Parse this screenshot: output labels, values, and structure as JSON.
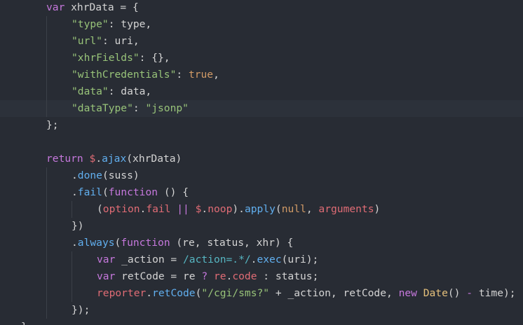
{
  "editor": {
    "theme_colors": {
      "background": "#282c34",
      "keyword": "#c678dd",
      "string": "#98c379",
      "function": "#61afef",
      "variable": "#e06c75",
      "number": "#d19a66",
      "plain": "#d4d4d4",
      "operator": "#56b6c2",
      "class": "#e5c07b"
    },
    "lines": [
      {
        "indent": 1,
        "tokens": [
          {
            "t": "var",
            "c": "keyword"
          },
          {
            "t": " xhrData = {",
            "c": "plain"
          }
        ]
      },
      {
        "indent": 2,
        "tokens": [
          {
            "t": "\"type\"",
            "c": "string"
          },
          {
            "t": ": type,",
            "c": "plain"
          }
        ]
      },
      {
        "indent": 2,
        "tokens": [
          {
            "t": "\"url\"",
            "c": "string"
          },
          {
            "t": ": uri,",
            "c": "plain"
          }
        ]
      },
      {
        "indent": 2,
        "tokens": [
          {
            "t": "\"xhrFields\"",
            "c": "string"
          },
          {
            "t": ": {},",
            "c": "plain"
          }
        ]
      },
      {
        "indent": 2,
        "tokens": [
          {
            "t": "\"withCredentials\"",
            "c": "string"
          },
          {
            "t": ": ",
            "c": "plain"
          },
          {
            "t": "true",
            "c": "number"
          },
          {
            "t": ",",
            "c": "plain"
          }
        ]
      },
      {
        "indent": 2,
        "tokens": [
          {
            "t": "\"data\"",
            "c": "string"
          },
          {
            "t": ": data,",
            "c": "plain"
          }
        ]
      },
      {
        "indent": 2,
        "highlight": true,
        "tokens": [
          {
            "t": "\"dataType\"",
            "c": "string"
          },
          {
            "t": ": ",
            "c": "plain"
          },
          {
            "t": "\"jsonp\"",
            "c": "string"
          }
        ]
      },
      {
        "indent": 1,
        "tokens": [
          {
            "t": "};",
            "c": "plain"
          }
        ]
      },
      {
        "indent": 0,
        "tokens": []
      },
      {
        "indent": 1,
        "tokens": [
          {
            "t": "return",
            "c": "keyword"
          },
          {
            "t": " ",
            "c": "plain"
          },
          {
            "t": "$",
            "c": "variable"
          },
          {
            "t": ".",
            "c": "plain"
          },
          {
            "t": "ajax",
            "c": "function"
          },
          {
            "t": "(xhrData)",
            "c": "plain"
          }
        ]
      },
      {
        "indent": 2,
        "tokens": [
          {
            "t": ".",
            "c": "plain"
          },
          {
            "t": "done",
            "c": "function"
          },
          {
            "t": "(suss)",
            "c": "plain"
          }
        ]
      },
      {
        "indent": 2,
        "tokens": [
          {
            "t": ".",
            "c": "plain"
          },
          {
            "t": "fail",
            "c": "function"
          },
          {
            "t": "(",
            "c": "plain"
          },
          {
            "t": "function",
            "c": "keyword"
          },
          {
            "t": " () {",
            "c": "plain"
          }
        ]
      },
      {
        "indent": 3,
        "tokens": [
          {
            "t": "(",
            "c": "plain"
          },
          {
            "t": "option",
            "c": "variable"
          },
          {
            "t": ".",
            "c": "plain"
          },
          {
            "t": "fail",
            "c": "variable"
          },
          {
            "t": " || ",
            "c": "keyword"
          },
          {
            "t": "$",
            "c": "variable"
          },
          {
            "t": ".",
            "c": "plain"
          },
          {
            "t": "noop",
            "c": "variable"
          },
          {
            "t": ").",
            "c": "plain"
          },
          {
            "t": "apply",
            "c": "function"
          },
          {
            "t": "(",
            "c": "plain"
          },
          {
            "t": "null",
            "c": "number"
          },
          {
            "t": ", ",
            "c": "plain"
          },
          {
            "t": "arguments",
            "c": "variable"
          },
          {
            "t": ")",
            "c": "plain"
          }
        ]
      },
      {
        "indent": 2,
        "tokens": [
          {
            "t": "})",
            "c": "plain"
          }
        ]
      },
      {
        "indent": 2,
        "tokens": [
          {
            "t": ".",
            "c": "plain"
          },
          {
            "t": "always",
            "c": "function"
          },
          {
            "t": "(",
            "c": "plain"
          },
          {
            "t": "function",
            "c": "keyword"
          },
          {
            "t": " (re, status, xhr) {",
            "c": "plain"
          }
        ]
      },
      {
        "indent": 3,
        "tokens": [
          {
            "t": "var",
            "c": "keyword"
          },
          {
            "t": " _action = ",
            "c": "plain"
          },
          {
            "t": "/action=.*/",
            "c": "operator"
          },
          {
            "t": ".",
            "c": "plain"
          },
          {
            "t": "exec",
            "c": "function"
          },
          {
            "t": "(uri);",
            "c": "plain"
          }
        ]
      },
      {
        "indent": 3,
        "tokens": [
          {
            "t": "var",
            "c": "keyword"
          },
          {
            "t": " retCode = re ",
            "c": "plain"
          },
          {
            "t": "?",
            "c": "keyword"
          },
          {
            "t": " ",
            "c": "plain"
          },
          {
            "t": "re",
            "c": "variable"
          },
          {
            "t": ".",
            "c": "plain"
          },
          {
            "t": "code",
            "c": "variable"
          },
          {
            "t": " : status;",
            "c": "plain"
          }
        ]
      },
      {
        "indent": 3,
        "tokens": [
          {
            "t": "reporter",
            "c": "variable"
          },
          {
            "t": ".",
            "c": "plain"
          },
          {
            "t": "retCode",
            "c": "function"
          },
          {
            "t": "(",
            "c": "plain"
          },
          {
            "t": "\"/cgi/sms?\"",
            "c": "string"
          },
          {
            "t": " + _action, retCode, ",
            "c": "plain"
          },
          {
            "t": "new",
            "c": "keyword"
          },
          {
            "t": " ",
            "c": "plain"
          },
          {
            "t": "Date",
            "c": "class"
          },
          {
            "t": "() ",
            "c": "plain"
          },
          {
            "t": "-",
            "c": "keyword"
          },
          {
            "t": " time);",
            "c": "plain"
          }
        ]
      },
      {
        "indent": 2,
        "tokens": [
          {
            "t": "});",
            "c": "plain"
          }
        ]
      },
      {
        "indent": 0,
        "tokens": [
          {
            "t": "}",
            "c": "plain"
          }
        ]
      }
    ]
  }
}
